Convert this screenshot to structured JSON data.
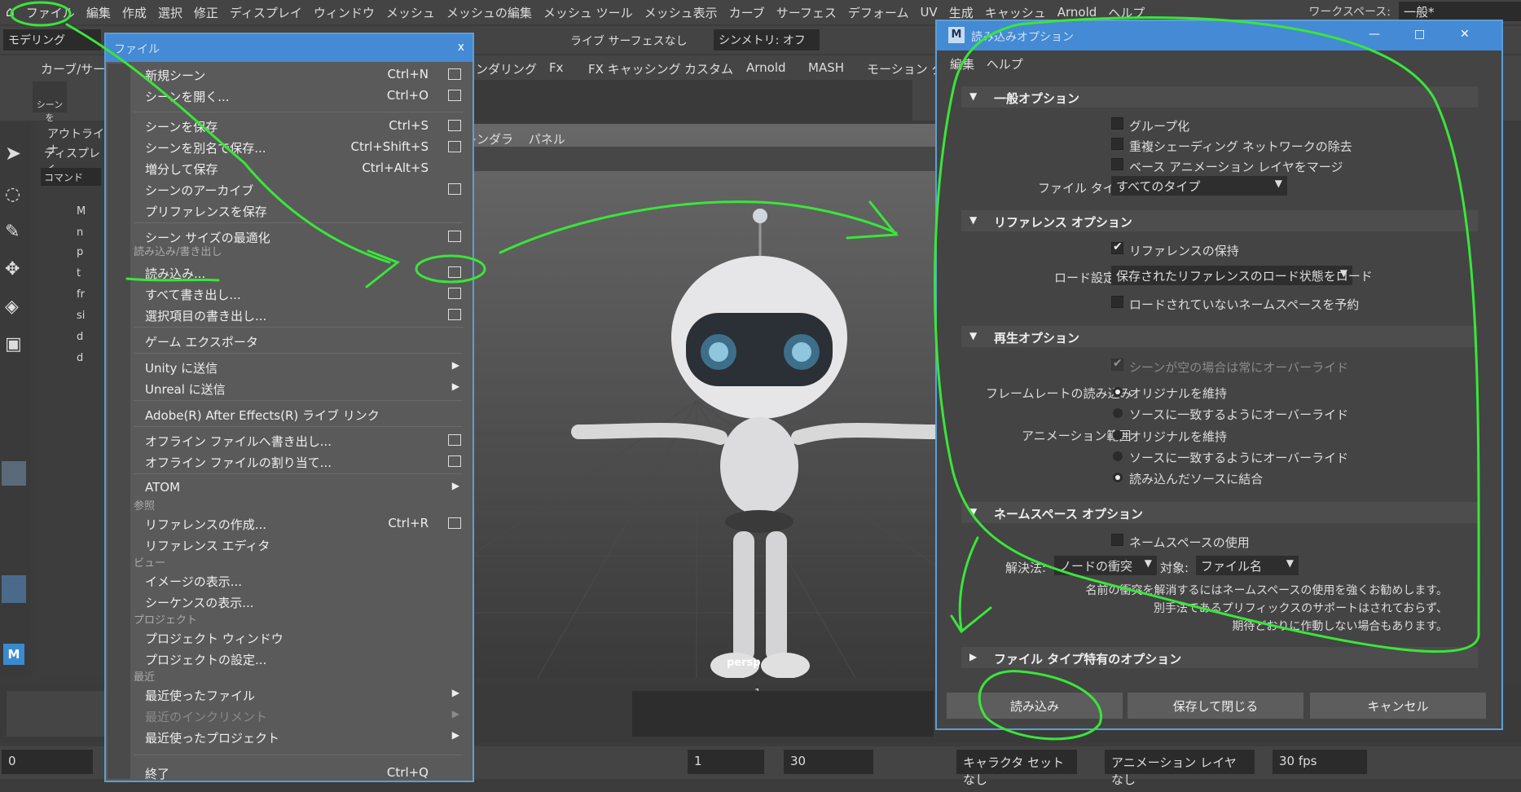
{
  "menubar": {
    "items": [
      "ファイル",
      "編集",
      "作成",
      "選択",
      "修正",
      "ディスプレイ",
      "ウィンドウ",
      "メッシュ",
      "メッシュの編集",
      "メッシュ ツール",
      "メッシュ表示",
      "カーブ",
      "サーフェス",
      "デフォーム",
      "UV",
      "生成",
      "キャッシュ",
      "Arnold",
      "ヘルプ"
    ],
    "workspace_label": "ワークスペース:",
    "workspace_value": "一般*"
  },
  "status": {
    "mode": "モデリング",
    "live_surface": "ライブ サーフェスなし",
    "symmetry": "シンメトリ: オフ"
  },
  "shelf": {
    "tabs": [
      "カーブ/サーフ",
      "ンダリング",
      "Fx",
      "FX キャッシング",
      "カスタム",
      "Arnold",
      "MASH",
      "モーション グラ"
    ],
    "scene_label": "シーンを"
  },
  "viewport": {
    "menu": [
      "レンダラ",
      "パネル"
    ],
    "camera": "persp"
  },
  "outliner": {
    "title": "アウトライナ",
    "display": "ディスプレイ",
    "command": "コマンド",
    "items": [
      "M",
      "n",
      "p",
      "t",
      "fr",
      "si",
      "d",
      "d"
    ]
  },
  "filemenu": {
    "title": "ファイル",
    "close": "x",
    "items": [
      {
        "label": "新規シーン",
        "shortcut": "Ctrl+N",
        "box": true
      },
      {
        "label": "シーンを開く...",
        "shortcut": "Ctrl+O",
        "box": true
      },
      {
        "label": "シーンを保存",
        "shortcut": "Ctrl+S",
        "box": true
      },
      {
        "label": "シーンを別名で保存...",
        "shortcut": "Ctrl+Shift+S",
        "box": true
      },
      {
        "label": "増分して保存",
        "shortcut": "Ctrl+Alt+S",
        "box": false
      },
      {
        "label": "シーンのアーカイブ",
        "shortcut": "",
        "box": true
      },
      {
        "label": "プリファレンスを保存",
        "shortcut": "",
        "box": false
      },
      {
        "label": "シーン サイズの最適化",
        "shortcut": "",
        "box": true
      },
      {
        "label": "読み込み...",
        "shortcut": "",
        "box": true
      },
      {
        "label": "すべて書き出し...",
        "shortcut": "",
        "box": true
      },
      {
        "label": "選択項目の書き出し...",
        "shortcut": "",
        "box": true
      },
      {
        "label": "ゲーム エクスポータ",
        "shortcut": "",
        "box": false
      },
      {
        "label": "Unity に送信",
        "shortcut": "",
        "arrow": true
      },
      {
        "label": "Unreal に送信",
        "shortcut": "",
        "arrow": true
      },
      {
        "label": "Adobe(R) After Effects(R) ライブ リンク",
        "shortcut": "",
        "box": false
      },
      {
        "label": "オフライン ファイルへ書き出し...",
        "shortcut": "",
        "box": true
      },
      {
        "label": "オフライン ファイルの割り当て...",
        "shortcut": "",
        "box": true
      },
      {
        "label": "ATOM",
        "shortcut": "",
        "arrow": true
      },
      {
        "label": "リファレンスの作成...",
        "shortcut": "Ctrl+R",
        "box": true
      },
      {
        "label": "リファレンス エディタ",
        "shortcut": "",
        "box": false
      },
      {
        "label": "イメージの表示...",
        "shortcut": "",
        "box": false
      },
      {
        "label": "シーケンスの表示...",
        "shortcut": "",
        "box": false
      },
      {
        "label": "プロジェクト ウィンドウ",
        "shortcut": "",
        "box": false
      },
      {
        "label": "プロジェクトの設定...",
        "shortcut": "",
        "box": false
      },
      {
        "label": "最近使ったファイル",
        "shortcut": "",
        "arrow": true
      },
      {
        "label": "最近のインクリメント",
        "shortcut": "",
        "arrow": true,
        "disabled": true
      },
      {
        "label": "最近使ったプロジェクト",
        "shortcut": "",
        "arrow": true
      },
      {
        "label": "終了",
        "shortcut": "Ctrl+Q",
        "box": false
      }
    ],
    "sections": [
      "読み込み/書き出し",
      "参照",
      "ビュー",
      "プロジェクト",
      "最近"
    ]
  },
  "dialog": {
    "title": "読み込みオプション",
    "menu": [
      "編集",
      "ヘルプ"
    ],
    "general": {
      "header": "一般オプション",
      "group": "グループ化",
      "remove_dup": "重複シェーディング ネットワークの除去",
      "merge_base": "ベース アニメーション レイヤをマージ",
      "file_type_label": "ファイル タイプ:",
      "file_type": "すべてのタイプ"
    },
    "reference": {
      "header": "リファレンス オプション",
      "preserve": "リファレンスの保持",
      "load_label": "ロード設定",
      "load_value": "保存されたリファレンスのロード状態をロード",
      "reserve_ns": "ロードされていないネームスペースを予約"
    },
    "playback": {
      "header": "再生オプション",
      "override_empty": "シーンが空の場合は常にオーバーライド",
      "framerate_label": "フレームレートの読み込み",
      "keep_original": "オリジナルを維持",
      "override_source": "ソースに一致するようにオーバーライド",
      "anim_range_label": "アニメーション範囲",
      "keep_original2": "オリジナルを維持",
      "override_source2": "ソースに一致するようにオーバーライド",
      "combine": "読み込んだソースに結合"
    },
    "namespace": {
      "header": "ネームスペース オプション",
      "use_ns": "ネームスペースの使用",
      "resolve_label": "解決法:",
      "resolve_value": "ノードの衝突",
      "target_label": "対象:",
      "target_value": "ファイル名",
      "note": [
        "名前の衝突を解消するにはネームスペースの使用を強くお勧めします。",
        "別手法であるプリフィックスのサポートはされておらず、",
        "期待どおりに作動しない場合もあります。"
      ]
    },
    "filetype_specific": {
      "header": "ファイル タイプ特有のオプション"
    },
    "buttons": {
      "import": "読み込み",
      "save_close": "保存して閉じる",
      "cancel": "キャンセル"
    }
  },
  "timeline": {
    "marker": "1"
  },
  "bottom": {
    "frame": "0",
    "start": "1",
    "end": "30",
    "character": "キャラクタ セットなし",
    "anim_layer": "アニメーション レイヤなし",
    "fps": "30 fps"
  }
}
